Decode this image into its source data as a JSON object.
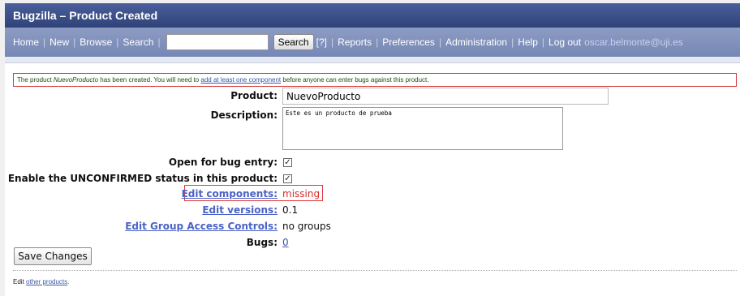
{
  "window": {
    "title": "Bugzilla – Product Created"
  },
  "nav": {
    "items": [
      "Home",
      "New",
      "Browse",
      "Search"
    ],
    "search_button": "Search",
    "help_marker": "[?]",
    "items_after": [
      "Reports",
      "Preferences",
      "Administration",
      "Help",
      "Log out"
    ],
    "user_email": "oscar.belmonte@uji.es",
    "separator": "|"
  },
  "message": {
    "prefix": "The product ",
    "product_name": "NuevoProducto",
    "middle": " has been created. You will need to ",
    "link_text": "add at least one component",
    "suffix": " before anyone can enter bugs against this product."
  },
  "form": {
    "product_label": "Product:",
    "product_value": "NuevoProducto",
    "description_label": "Description:",
    "description_value": "Este es un producto de prueba",
    "open_label": "Open for bug entry:",
    "open_checked": true,
    "unconfirmed_label": "Enable the UNCONFIRMED status in this product:",
    "unconfirmed_checked": true,
    "components_label": "Edit components:",
    "components_value": "missing",
    "versions_label": "Edit versions:",
    "versions_value": "0.1",
    "group_label": "Edit Group Access Controls:",
    "group_value": "no groups",
    "bugs_label": "Bugs:",
    "bugs_value": "0",
    "checkmark": "✓"
  },
  "actions": {
    "save_label": "Save Changes"
  },
  "footer": {
    "prefix": "Edit ",
    "link_text": "other products",
    "suffix": "."
  },
  "colors": {
    "titlebar": "#3a4f8a",
    "navbar": "#8090bc",
    "link": "#4b63c6",
    "missing": "#d42d2d",
    "error_border": "#e23a3a"
  }
}
